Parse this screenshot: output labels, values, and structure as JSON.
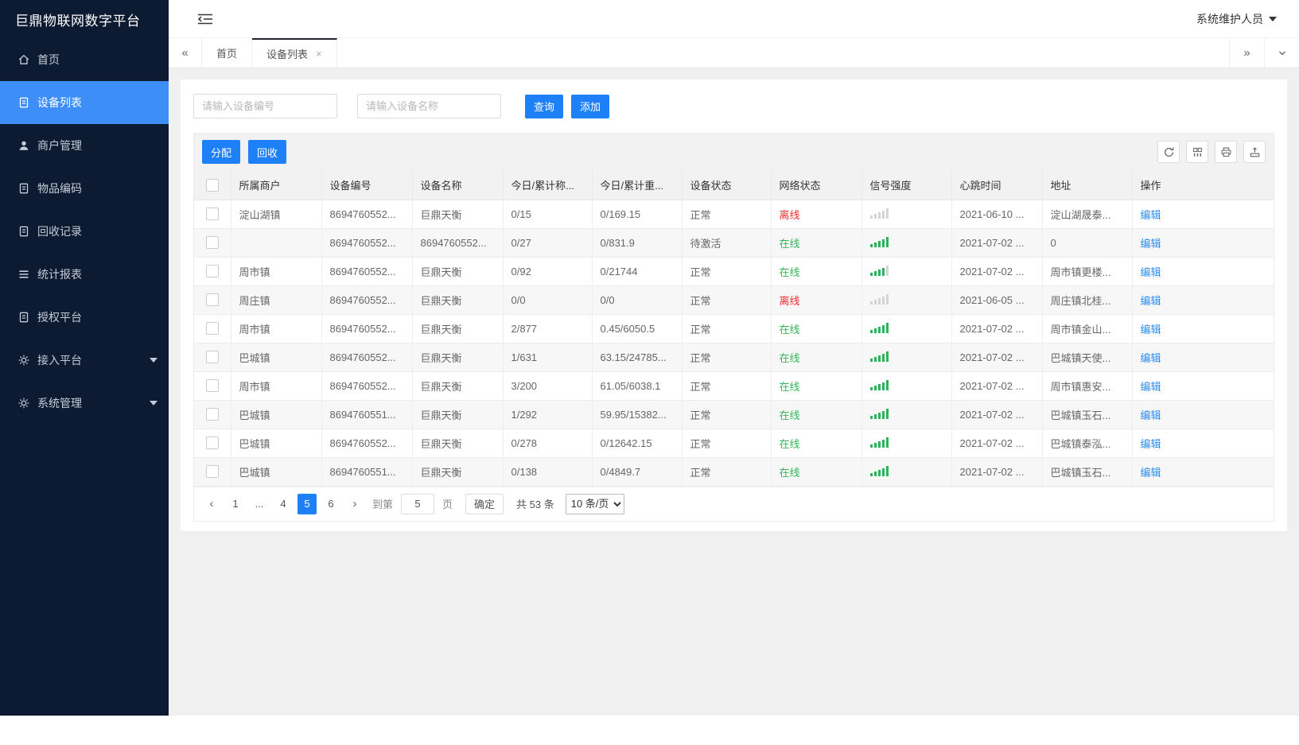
{
  "app": {
    "logo": "巨鼎物联网数字平台",
    "user": "系统维护人员"
  },
  "colors": {
    "accent_blue": "#1e80f7",
    "sidebar_active": "#3e8ef7",
    "online_green": "#35b558",
    "offline_red": "#f22c2c",
    "link_blue": "#2d8cf0",
    "sidebar_bg": "#0d1b32"
  },
  "sidebar": {
    "items": [
      {
        "key": "home",
        "label": "首页",
        "icon": "home-icon",
        "active": false,
        "arrow": false
      },
      {
        "key": "device-list",
        "label": "设备列表",
        "icon": "doc-icon",
        "active": true,
        "arrow": false
      },
      {
        "key": "merchant-mgmt",
        "label": "商户管理",
        "icon": "user-icon",
        "active": false,
        "arrow": false
      },
      {
        "key": "item-code",
        "label": "物品编码",
        "icon": "doc-icon",
        "active": false,
        "arrow": false
      },
      {
        "key": "recycle-record",
        "label": "回收记录",
        "icon": "doc-icon",
        "active": false,
        "arrow": false
      },
      {
        "key": "stat-report",
        "label": "统计报表",
        "icon": "menu-icon",
        "active": false,
        "arrow": false
      },
      {
        "key": "auth-platform",
        "label": "授权平台",
        "icon": "doc-icon",
        "active": false,
        "arrow": false
      },
      {
        "key": "access-platform",
        "label": "接入平台",
        "icon": "gear-icon",
        "active": false,
        "arrow": true
      },
      {
        "key": "system-mgmt",
        "label": "系统管理",
        "icon": "gear-icon",
        "active": false,
        "arrow": true
      }
    ]
  },
  "tabs": [
    {
      "label": "首页",
      "active": false,
      "closable": false
    },
    {
      "label": "设备列表",
      "active": true,
      "closable": true
    }
  ],
  "search": {
    "device_no_placeholder": "请输入设备编号",
    "device_name_placeholder": "请输入设备名称",
    "query_label": "查询",
    "add_label": "添加"
  },
  "toolbar": {
    "assign_label": "分配",
    "recycle_label": "回收"
  },
  "table": {
    "columns": [
      "所属商户",
      "设备编号",
      "设备名称",
      "今日/累计称...",
      "今日/累计重...",
      "设备状态",
      "网络状态",
      "信号强度",
      "心跳时间",
      "地址",
      "操作"
    ],
    "edit_label": "编辑",
    "rows": [
      {
        "merchant": "淀山湖镇",
        "device_no": "8694760552...",
        "device_name": "巨鼎天衡",
        "today_count": "0/15",
        "today_weight": "0/169.15",
        "device_status": "正常",
        "network_status": "离线",
        "online": false,
        "signal": 0,
        "heartbeat": "2021-06-10 ...",
        "address": "淀山湖晟泰..."
      },
      {
        "merchant": "",
        "device_no": "8694760552...",
        "device_name": "8694760552...",
        "today_count": "0/27",
        "today_weight": "0/831.9",
        "device_status": "待激活",
        "network_status": "在线",
        "online": true,
        "signal": 5,
        "heartbeat": "2021-07-02 ...",
        "address": "0"
      },
      {
        "merchant": "周市镇",
        "device_no": "8694760552...",
        "device_name": "巨鼎天衡",
        "today_count": "0/92",
        "today_weight": "0/21744",
        "device_status": "正常",
        "network_status": "在线",
        "online": true,
        "signal": 4,
        "heartbeat": "2021-07-02 ...",
        "address": "周市镇更楼..."
      },
      {
        "merchant": "周庄镇",
        "device_no": "8694760552...",
        "device_name": "巨鼎天衡",
        "today_count": "0/0",
        "today_weight": "0/0",
        "device_status": "正常",
        "network_status": "离线",
        "online": false,
        "signal": 0,
        "heartbeat": "2021-06-05 ...",
        "address": "周庄镇北桂..."
      },
      {
        "merchant": "周市镇",
        "device_no": "8694760552...",
        "device_name": "巨鼎天衡",
        "today_count": "2/877",
        "today_weight": "0.45/6050.5",
        "device_status": "正常",
        "network_status": "在线",
        "online": true,
        "signal": 5,
        "heartbeat": "2021-07-02 ...",
        "address": "周市镇金山..."
      },
      {
        "merchant": "巴城镇",
        "device_no": "8694760552...",
        "device_name": "巨鼎天衡",
        "today_count": "1/631",
        "today_weight": "63.15/24785...",
        "device_status": "正常",
        "network_status": "在线",
        "online": true,
        "signal": 5,
        "heartbeat": "2021-07-02 ...",
        "address": "巴城镇天使..."
      },
      {
        "merchant": "周市镇",
        "device_no": "8694760552...",
        "device_name": "巨鼎天衡",
        "today_count": "3/200",
        "today_weight": "61.05/6038.1",
        "device_status": "正常",
        "network_status": "在线",
        "online": true,
        "signal": 5,
        "heartbeat": "2021-07-02 ...",
        "address": "周市镇惠安..."
      },
      {
        "merchant": "巴城镇",
        "device_no": "8694760551...",
        "device_name": "巨鼎天衡",
        "today_count": "1/292",
        "today_weight": "59.95/15382...",
        "device_status": "正常",
        "network_status": "在线",
        "online": true,
        "signal": 5,
        "heartbeat": "2021-07-02 ...",
        "address": "巴城镇玉石..."
      },
      {
        "merchant": "巴城镇",
        "device_no": "8694760552...",
        "device_name": "巨鼎天衡",
        "today_count": "0/278",
        "today_weight": "0/12642.15",
        "device_status": "正常",
        "network_status": "在线",
        "online": true,
        "signal": 5,
        "heartbeat": "2021-07-02 ...",
        "address": "巴城镇泰泓..."
      },
      {
        "merchant": "巴城镇",
        "device_no": "8694760551...",
        "device_name": "巨鼎天衡",
        "today_count": "0/138",
        "today_weight": "0/4849.7",
        "device_status": "正常",
        "network_status": "在线",
        "online": true,
        "signal": 5,
        "heartbeat": "2021-07-02 ...",
        "address": "巴城镇玉石..."
      }
    ]
  },
  "pagination": {
    "pages": [
      "1",
      "...",
      "4",
      "5",
      "6"
    ],
    "active_page": "5",
    "goto_prefix": "到第",
    "goto_value": "5",
    "goto_suffix": "页",
    "confirm_label": "确定",
    "total_label": "共 53 条",
    "page_size": "10 条/页"
  }
}
